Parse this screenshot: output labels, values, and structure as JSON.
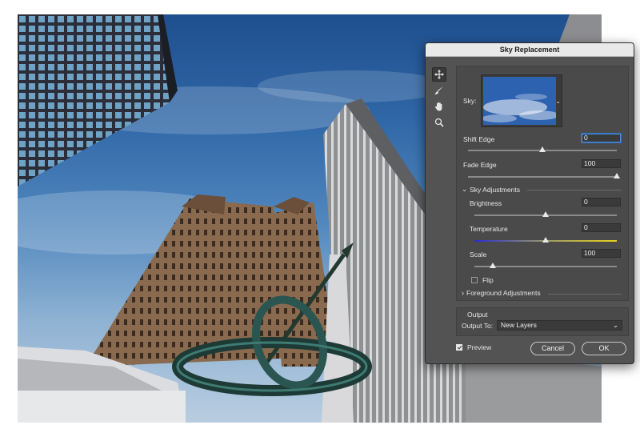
{
  "dialog": {
    "title": "Sky Replacement",
    "tools": [
      {
        "name": "move-tool",
        "icon": "move-icon",
        "active": true
      },
      {
        "name": "sky-brush-tool",
        "icon": "brush-icon",
        "active": false
      },
      {
        "name": "hand-tool",
        "icon": "hand-icon",
        "active": false
      },
      {
        "name": "zoom-tool",
        "icon": "zoom-icon",
        "active": false
      }
    ],
    "sky_label": "Sky:",
    "shift_edge": {
      "label": "Shift Edge",
      "value": "0",
      "level": 0.5
    },
    "fade_edge": {
      "label": "Fade Edge",
      "value": "100",
      "level": 1.0
    },
    "sky_adjustments": {
      "label": "Sky Adjustments",
      "brightness": {
        "label": "Brightness",
        "value": "0",
        "level": 0.5
      },
      "temperature": {
        "label": "Temperature",
        "value": "0",
        "level": 0.5
      },
      "scale": {
        "label": "Scale",
        "value": "100",
        "level": 0.13
      },
      "flip_label": "Flip",
      "flip_checked": false
    },
    "foreground_adjustments_label": "Foreground Adjustments",
    "output": {
      "label": "Output",
      "output_to_label": "Output To:",
      "output_to_value": "New Layers"
    },
    "preview_label": "Preview",
    "preview_checked": true,
    "cancel_label": "Cancel",
    "ok_label": "OK"
  },
  "colors": {
    "dialog_bg": "#535353",
    "panel_bg": "#4a4a4a",
    "title_bg": "#e9e9e9",
    "focus_blue": "#4a8ee0"
  }
}
